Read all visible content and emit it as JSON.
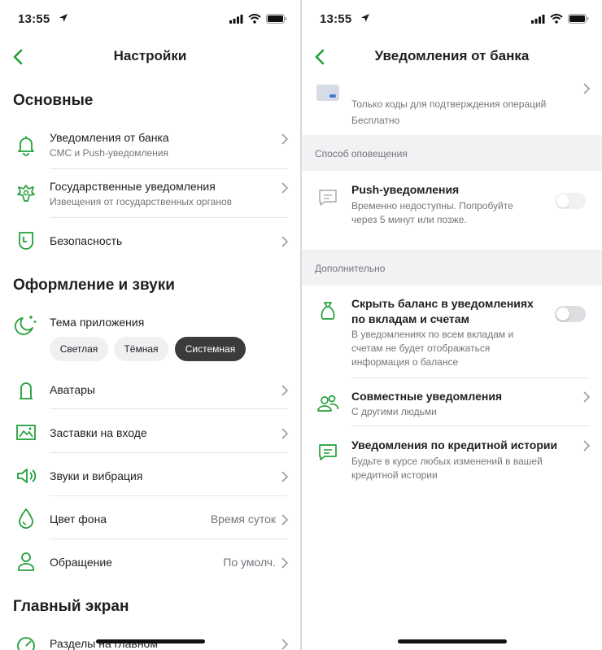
{
  "status": {
    "time": "13:55"
  },
  "left": {
    "title": "Настройки",
    "sections": [
      {
        "header": "Основные"
      },
      {
        "header": "Оформление и звуки"
      },
      {
        "header": "Главный экран"
      }
    ],
    "items": {
      "notifications": {
        "title": "Уведомления от банка",
        "sub": "СМС и Push-уведомления"
      },
      "gov": {
        "title": "Государственные уведомления",
        "sub": "Извещения от государственных органов"
      },
      "security": {
        "title": "Безопасность"
      },
      "theme": {
        "title": "Тема приложения",
        "options": [
          "Светлая",
          "Тёмная",
          "Системная"
        ],
        "selected": "Системная"
      },
      "avatars": {
        "title": "Аватары"
      },
      "splash": {
        "title": "Заставки на входе"
      },
      "sounds": {
        "title": "Звуки и вибрация"
      },
      "bg": {
        "title": "Цвет фона",
        "value": "Время суток"
      },
      "address": {
        "title": "Обращение",
        "value": "По умолч."
      },
      "sections_main": {
        "title": "Разделы на главном"
      }
    }
  },
  "right": {
    "title": "Уведомления от банка",
    "card": {
      "title": "Только коды для подтверждения операций",
      "sub": "Бесплатно"
    },
    "band1": "Способ оповещения",
    "push": {
      "title": "Push-уведомления",
      "sub": "Временно недоступны. Попробуйте через 5 минут или позже.",
      "toggle": false
    },
    "band2": "Дополнительно",
    "hide_balance": {
      "title": "Скрыть баланс в уведомлениях по вкладам и счетам",
      "sub": "В уведомлениях по всем вкладам и счетам не будет отображаться информация о балансе",
      "toggle": false
    },
    "joint": {
      "title": "Совместные уведомления",
      "sub": "С другими людьми"
    },
    "credit": {
      "title": "Уведомления по кредитной истории",
      "sub": "Будьте в курсе любых изменений в вашей кредитной истории"
    }
  },
  "colors": {
    "accent": "#21a038",
    "text": "#1f1f22",
    "secondary": "#74747c",
    "chip_selected": "#3b3b3d"
  }
}
